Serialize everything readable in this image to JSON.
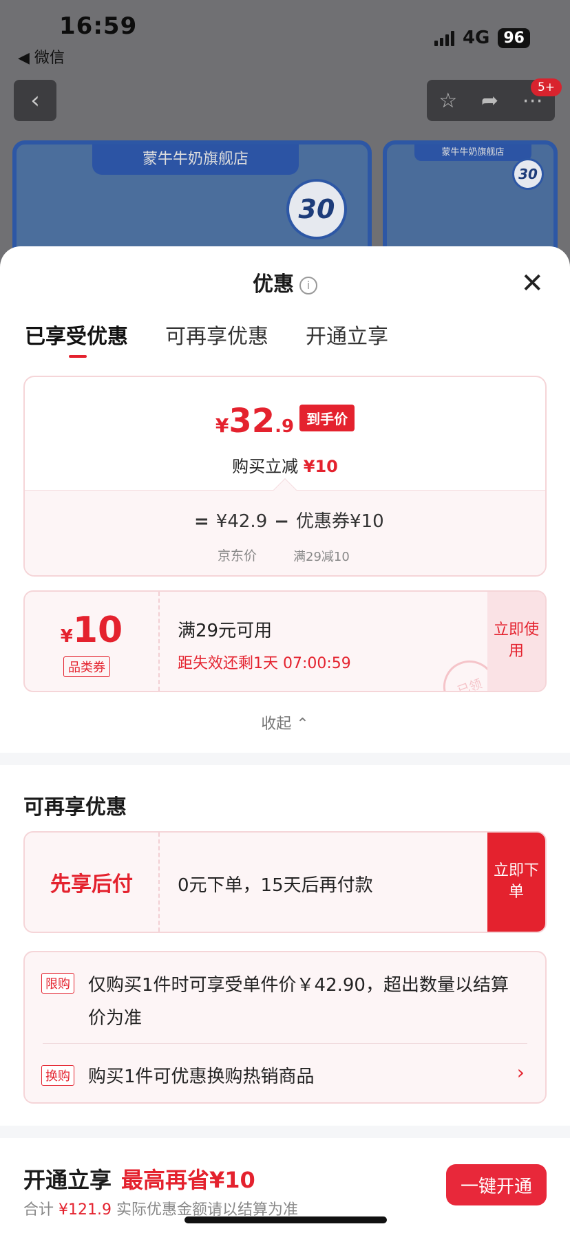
{
  "status_bar": {
    "time": "16:59",
    "back_app": "◀ 微信",
    "network": "4G",
    "battery": "96"
  },
  "background": {
    "shop_name": "蒙牛牛奶旗舰店",
    "gold_badge": "30",
    "notification_count": "5+"
  },
  "sheet": {
    "title": "优惠",
    "tabs": [
      "已享受优惠",
      "可再享优惠",
      "开通立享"
    ],
    "price": {
      "currency": "¥",
      "integer": "32",
      "decimal": ".9",
      "tag": "到手价"
    },
    "reduce": {
      "label": "购买立减",
      "amount": "¥10"
    },
    "calc": {
      "equals": "=",
      "base": "¥42.9",
      "minus": "−",
      "coupon": "优惠券¥10",
      "base_label": "京东价",
      "coupon_rule": "满29减10"
    },
    "coupon": {
      "currency": "¥",
      "amount": "10",
      "type": "品类券",
      "condition": "满29元可用",
      "expiry": "距失效还剩1天 07:00:59",
      "action": "立即使用",
      "stamp": "已领"
    },
    "collapse": "收起 ⌃",
    "more_title": "可再享优惠",
    "pay_later": {
      "label": "先享后付",
      "desc": "0元下单，15天后再付款",
      "action": "立即下单"
    },
    "limits": [
      {
        "tag": "限购",
        "text": "仅购买1件时可享受单件价￥42.90，超出数量以结算价为准"
      },
      {
        "tag": "换购",
        "text": "购买1件可优惠换购热销商品"
      }
    ],
    "open": {
      "title": "开通立享",
      "highlight": "最高再省¥10",
      "sub_prefix": "合计",
      "sub_total": "¥121.9",
      "sub_suffix": "实际优惠金额请以结算为准",
      "button": "一键开通"
    }
  },
  "colors": {
    "accent": "#e4222e",
    "card_bg": "#fdf5f6",
    "card_border": "#f5d5d8"
  }
}
